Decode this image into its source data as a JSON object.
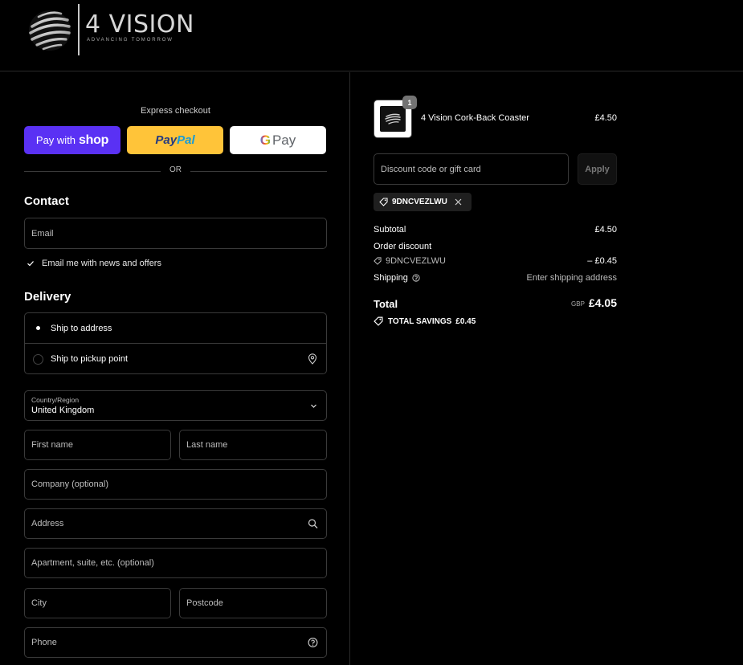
{
  "brand": {
    "name": "4 VISION",
    "tagline": "ADVANCING TOMORROW"
  },
  "express": {
    "label": "Express checkout",
    "shop_prefix": "Pay with",
    "shop_word": "shop",
    "paypal_a": "Pay",
    "paypal_b": "Pal",
    "gpay_g": "G",
    "gpay_word": "Pay",
    "or": "OR"
  },
  "contact": {
    "heading": "Contact",
    "email_placeholder": "Email",
    "newsletter_label": "Email me with news and offers",
    "newsletter_checked": true
  },
  "delivery": {
    "heading": "Delivery",
    "option_ship": "Ship to address",
    "option_pickup": "Ship to pickup point",
    "selected": "ship",
    "country_label": "Country/Region",
    "country_value": "United Kingdom",
    "first_name": "First name",
    "last_name": "Last name",
    "company": "Company (optional)",
    "address": "Address",
    "apartment": "Apartment, suite, etc. (optional)",
    "city": "City",
    "postcode": "Postcode",
    "phone": "Phone"
  },
  "cart": {
    "item": {
      "name": "4 Vision Cork-Back Coaster",
      "price": "£4.50",
      "quantity": "1"
    },
    "discount_placeholder": "Discount code or gift card",
    "apply": "Apply",
    "applied_code": "9DNCVEZLWU"
  },
  "summary": {
    "subtotal_label": "Subtotal",
    "subtotal_value": "£4.50",
    "order_discount_label": "Order discount",
    "discount_code": "9DNCVEZLWU",
    "discount_value": "– £0.45",
    "shipping_label": "Shipping",
    "shipping_value": "Enter shipping address",
    "total_label": "Total",
    "currency": "GBP",
    "total_value": "£4.05",
    "savings_label": "TOTAL SAVINGS",
    "savings_value": "£0.45"
  },
  "colors": {
    "background": "#000000",
    "shop_pay": "#5a31f4",
    "paypal": "#ffc439",
    "gpay": "#ffffff",
    "border": "#3a3a3a"
  }
}
